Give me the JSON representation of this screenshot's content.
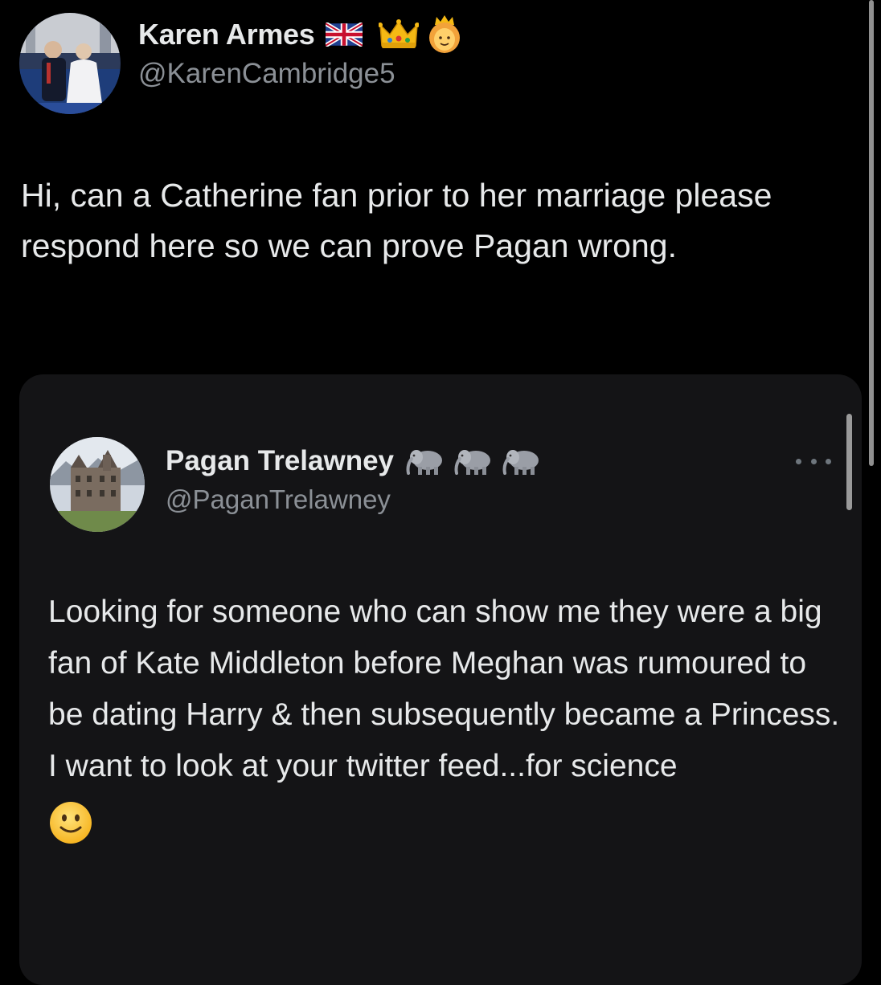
{
  "main_tweet": {
    "author_name": "Karen Armes",
    "author_emojis": [
      "uk-flag-emoji",
      "crown-emoji",
      "princess-emoji"
    ],
    "handle": "@KarenCambridge5",
    "text": "Hi, can a Catherine fan prior to her marriage please respond here so we can prove Pagan wrong."
  },
  "quoted_tweet": {
    "author_name": "Pagan Trelawney",
    "author_emojis": [
      "elephant-emoji",
      "elephant-emoji",
      "elephant-emoji"
    ],
    "handle": "@PaganTrelawney",
    "text": "Looking for someone who can show me they were a big fan of Kate Middleton before Meghan was rumoured to be dating Harry & then subsequently became a Princess.\nI want to look at your twitter feed...for science",
    "trailing_emoji": "slightly-smiling-face-emoji"
  },
  "colors": {
    "background": "#000000",
    "card_background": "#141416",
    "primary_text": "#e7e9ea",
    "secondary_text": "#8b9096"
  }
}
